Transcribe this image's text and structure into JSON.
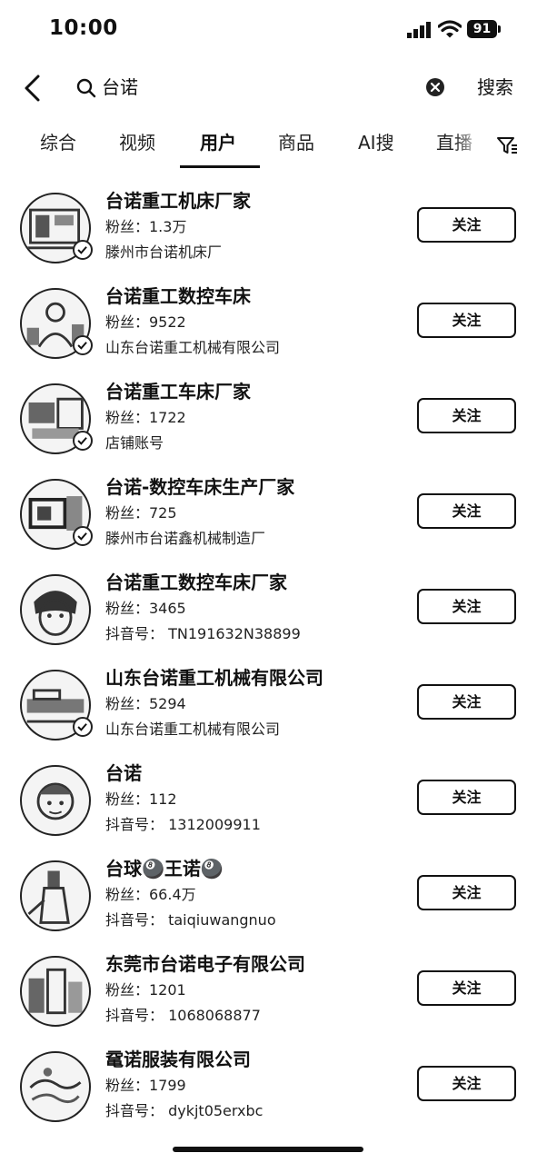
{
  "status_bar": {
    "time": "10:00",
    "battery": "91"
  },
  "search": {
    "query": "台诺",
    "submit_label": "搜索"
  },
  "tabs": [
    {
      "label": "综合",
      "active": false
    },
    {
      "label": "视频",
      "active": false
    },
    {
      "label": "用户",
      "active": true
    },
    {
      "label": "商品",
      "active": false
    },
    {
      "label": "AI搜",
      "active": false
    },
    {
      "label": "直播",
      "active": false
    }
  ],
  "users": [
    {
      "name": "台诺重工机床厂家",
      "fans": "粉丝：1.3万",
      "sub": "滕州市台诺机床厂",
      "verified": true,
      "follow_label": "关注"
    },
    {
      "name": "台诺重工数控车床",
      "fans": "粉丝：9522",
      "sub": "山东台诺重工机械有限公司",
      "verified": true,
      "follow_label": "关注"
    },
    {
      "name": "台诺重工车床厂家",
      "fans": "粉丝：1722",
      "sub": "店铺账号",
      "verified": true,
      "follow_label": "关注"
    },
    {
      "name": "台诺-数控车床生产厂家",
      "fans": "粉丝：725",
      "sub": "滕州市台诺鑫机械制造厂",
      "verified": true,
      "follow_label": "关注"
    },
    {
      "name": "台诺重工数控车床厂家",
      "fans": "粉丝：3465",
      "sub": "抖音号： TN191632N38899",
      "verified": false,
      "follow_label": "关注"
    },
    {
      "name": "山东台诺重工机械有限公司",
      "fans": "粉丝：5294",
      "sub": "山东台诺重工机械有限公司",
      "verified": true,
      "follow_label": "关注"
    },
    {
      "name": "台诺",
      "fans": "粉丝：112",
      "sub": "抖音号： 1312009911",
      "verified": false,
      "follow_label": "关注"
    },
    {
      "name": "台球🎱王诺🎱",
      "fans": "粉丝：66.4万",
      "sub": "抖音号： taiqiuwangnuo",
      "verified": false,
      "follow_label": "关注"
    },
    {
      "name": "东莞市台诺电子有限公司",
      "fans": "粉丝：1201",
      "sub": "抖音号： 1068068877",
      "verified": false,
      "follow_label": "关注"
    },
    {
      "name": "鼋诺服装有限公司",
      "fans": "粉丝：1799",
      "sub": "抖音号： dykjt05erxbc",
      "verified": false,
      "follow_label": "关注"
    }
  ]
}
